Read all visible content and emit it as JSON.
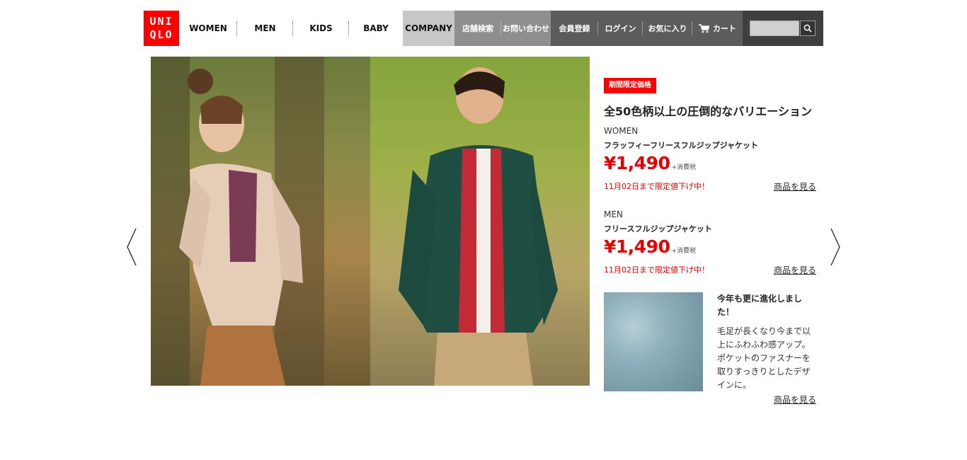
{
  "header": {
    "logo": [
      "UNI",
      "QLO"
    ],
    "nav": [
      "WOMEN",
      "MEN",
      "KIDS",
      "BABY"
    ],
    "company": "COMPANY",
    "links_grey": [
      "店舗検索",
      "お問い合わせ"
    ],
    "links_dark": [
      "会員登録",
      "ログイン",
      "お気に入り"
    ],
    "cart": "カート",
    "search": {
      "value": "",
      "placeholder": ""
    }
  },
  "promo": {
    "badge": "期間限定価格",
    "headline": "全50色柄以上の圧倒的なバリエーション",
    "products": [
      {
        "category": "WOMEN",
        "name": "フラッフィーフリースフルジップジャケット",
        "price": "¥1,490",
        "tax": "+消費税",
        "sale_note": "11月02日まで限定値下げ中！",
        "link": "商品を見る"
      },
      {
        "category": "MEN",
        "name": "フリースフルジップジャケット",
        "price": "¥1,490",
        "tax": "+消費税",
        "sale_note": "11月02日まで限定値下げ中！",
        "link": "商品を見る"
      }
    ],
    "feature": {
      "title": "今年も更に進化しました！",
      "body": "毛足が長くなり今まで以上にふわふわ感アップ。ポケットのファスナーを取りすっきりとしたデザインに。",
      "link": "商品を見る"
    }
  },
  "colors": {
    "brand_red": "#ff0000",
    "price_red": "#e40000"
  }
}
